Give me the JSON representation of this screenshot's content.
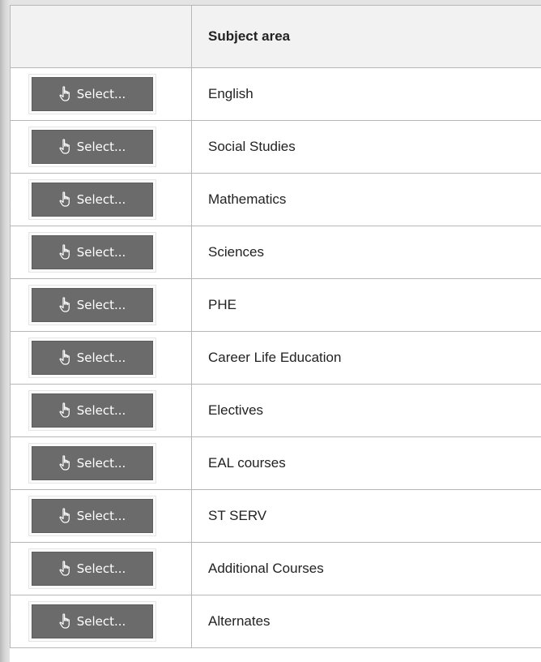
{
  "table": {
    "header": {
      "action_col": "",
      "subject_col": "Subject area"
    },
    "select_label": "Select...",
    "select_icon": "hand-pointer-icon",
    "rows": [
      {
        "subject": "English"
      },
      {
        "subject": "Social Studies"
      },
      {
        "subject": "Mathematics"
      },
      {
        "subject": "Sciences"
      },
      {
        "subject": "PHE"
      },
      {
        "subject": "Career Life Education"
      },
      {
        "subject": "Electives"
      },
      {
        "subject": "EAL courses"
      },
      {
        "subject": "ST SERV"
      },
      {
        "subject": "Additional Courses"
      },
      {
        "subject": "Alternates"
      }
    ]
  },
  "colors": {
    "button_bg": "#6b6b6b",
    "header_bg": "#f2f2f2",
    "border": "#b7b7b7"
  }
}
